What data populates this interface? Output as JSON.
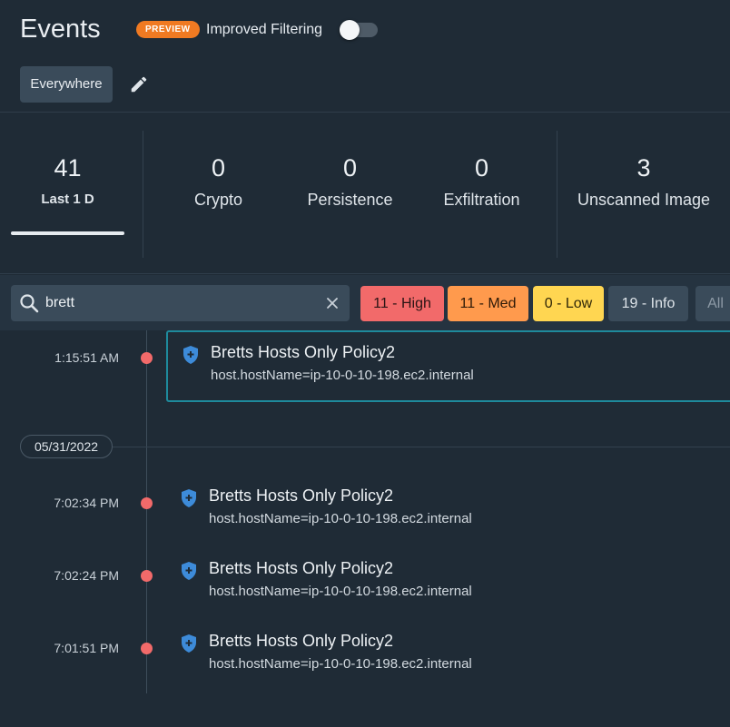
{
  "header": {
    "title": "Events",
    "preview_badge": "PREVIEW",
    "improved_filtering_label": "Improved Filtering",
    "improved_filtering_enabled": false,
    "scope_button": "Everywhere",
    "edit_icon": "pencil-icon"
  },
  "stats": [
    {
      "count": "41",
      "label": "Last 1 D",
      "active": true
    },
    {
      "count": "0",
      "label": "Crypto",
      "active": false
    },
    {
      "count": "0",
      "label": "Persistence",
      "active": false
    },
    {
      "count": "0",
      "label": "Exfiltration",
      "active": false
    },
    {
      "count": "3",
      "label": "Unscanned Image",
      "active": false
    }
  ],
  "filters": {
    "search_value": "brett",
    "search_icon": "search-icon",
    "clear_icon": "close-icon",
    "chips": {
      "high": "11 - High",
      "med": "11 - Med",
      "low": "0 - Low",
      "info": "19 - Info",
      "all": "All"
    },
    "colors": {
      "high": "#f26a6a",
      "med": "#ff9a4d",
      "low": "#ffd651",
      "neutral": "#3a4b5a"
    }
  },
  "timeline": {
    "events": [
      {
        "time": "1:15:51 AM",
        "title": "Bretts Hosts Only Policy2",
        "detail": "host.hostName=ip-10-0-10-198.ec2.internal",
        "selected": true,
        "icon": "shield-plus-icon"
      },
      {
        "time": "7:02:34 PM",
        "title": "Bretts Hosts Only Policy2",
        "detail": "host.hostName=ip-10-0-10-198.ec2.internal",
        "selected": false,
        "icon": "shield-plus-icon"
      },
      {
        "time": "7:02:24 PM",
        "title": "Bretts Hosts Only Policy2",
        "detail": "host.hostName=ip-10-0-10-198.ec2.internal",
        "selected": false,
        "icon": "shield-plus-icon"
      },
      {
        "time": "7:01:51 PM",
        "title": "Bretts Hosts Only Policy2",
        "detail": "host.hostName=ip-10-0-10-198.ec2.internal",
        "selected": false,
        "icon": "shield-plus-icon"
      }
    ],
    "date_divider": "05/31/2022",
    "dot_color": "#f26a6a"
  }
}
